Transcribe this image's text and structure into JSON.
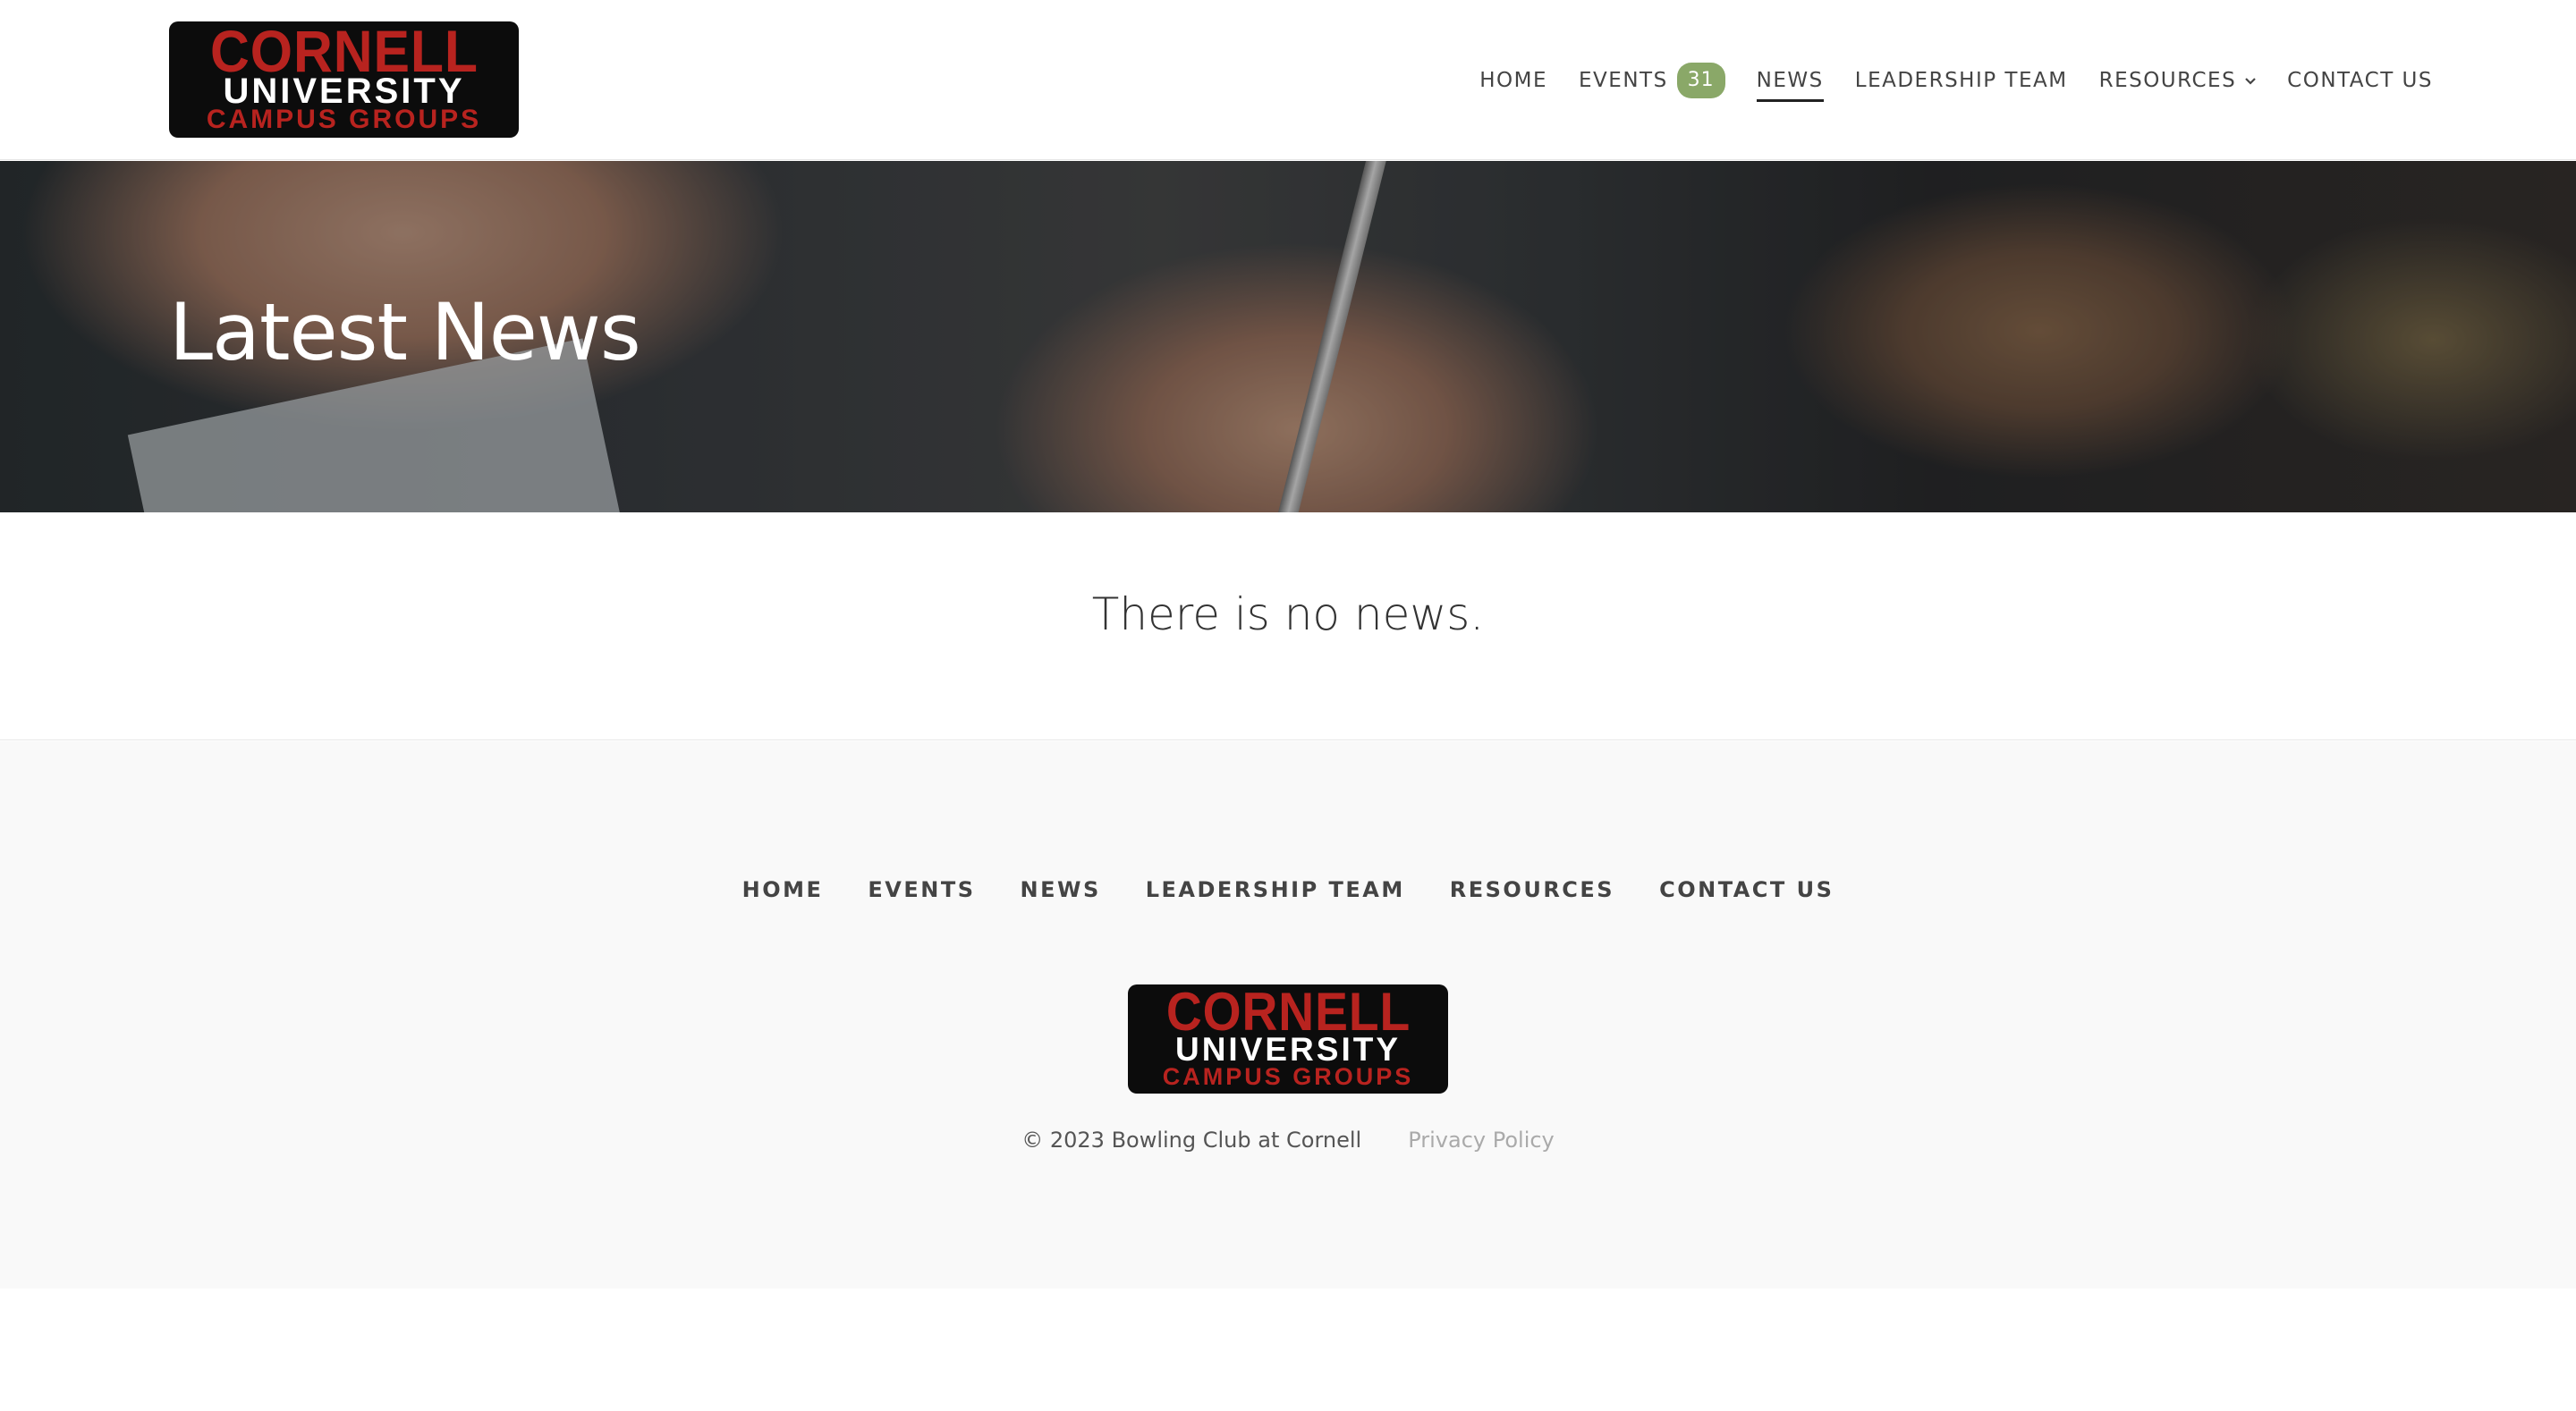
{
  "logo": {
    "line1": "CORNELL",
    "line2": "UNIVERSITY",
    "line3": "CAMPUS GROUPS"
  },
  "nav": {
    "home": "HOME",
    "events": "EVENTS",
    "events_count": "31",
    "news": "NEWS",
    "leadership": "LEADERSHIP TEAM",
    "resources": "RESOURCES",
    "contact": "CONTACT US",
    "active": "NEWS"
  },
  "hero": {
    "title": "Latest News"
  },
  "main": {
    "empty_message": "There is no news."
  },
  "footer": {
    "nav": [
      "HOME",
      "EVENTS",
      "NEWS",
      "LEADERSHIP TEAM",
      "RESOURCES",
      "CONTACT US"
    ],
    "copyright": "© 2023 Bowling Club at Cornell",
    "privacy": "Privacy Policy"
  },
  "colors": {
    "badge": "#8aa868",
    "logo_red": "#b8231f",
    "logo_bg": "#0c0c0c",
    "footer_bg": "#f9f9f9"
  },
  "icons": {
    "resources_dropdown": "chevron-down-icon"
  }
}
